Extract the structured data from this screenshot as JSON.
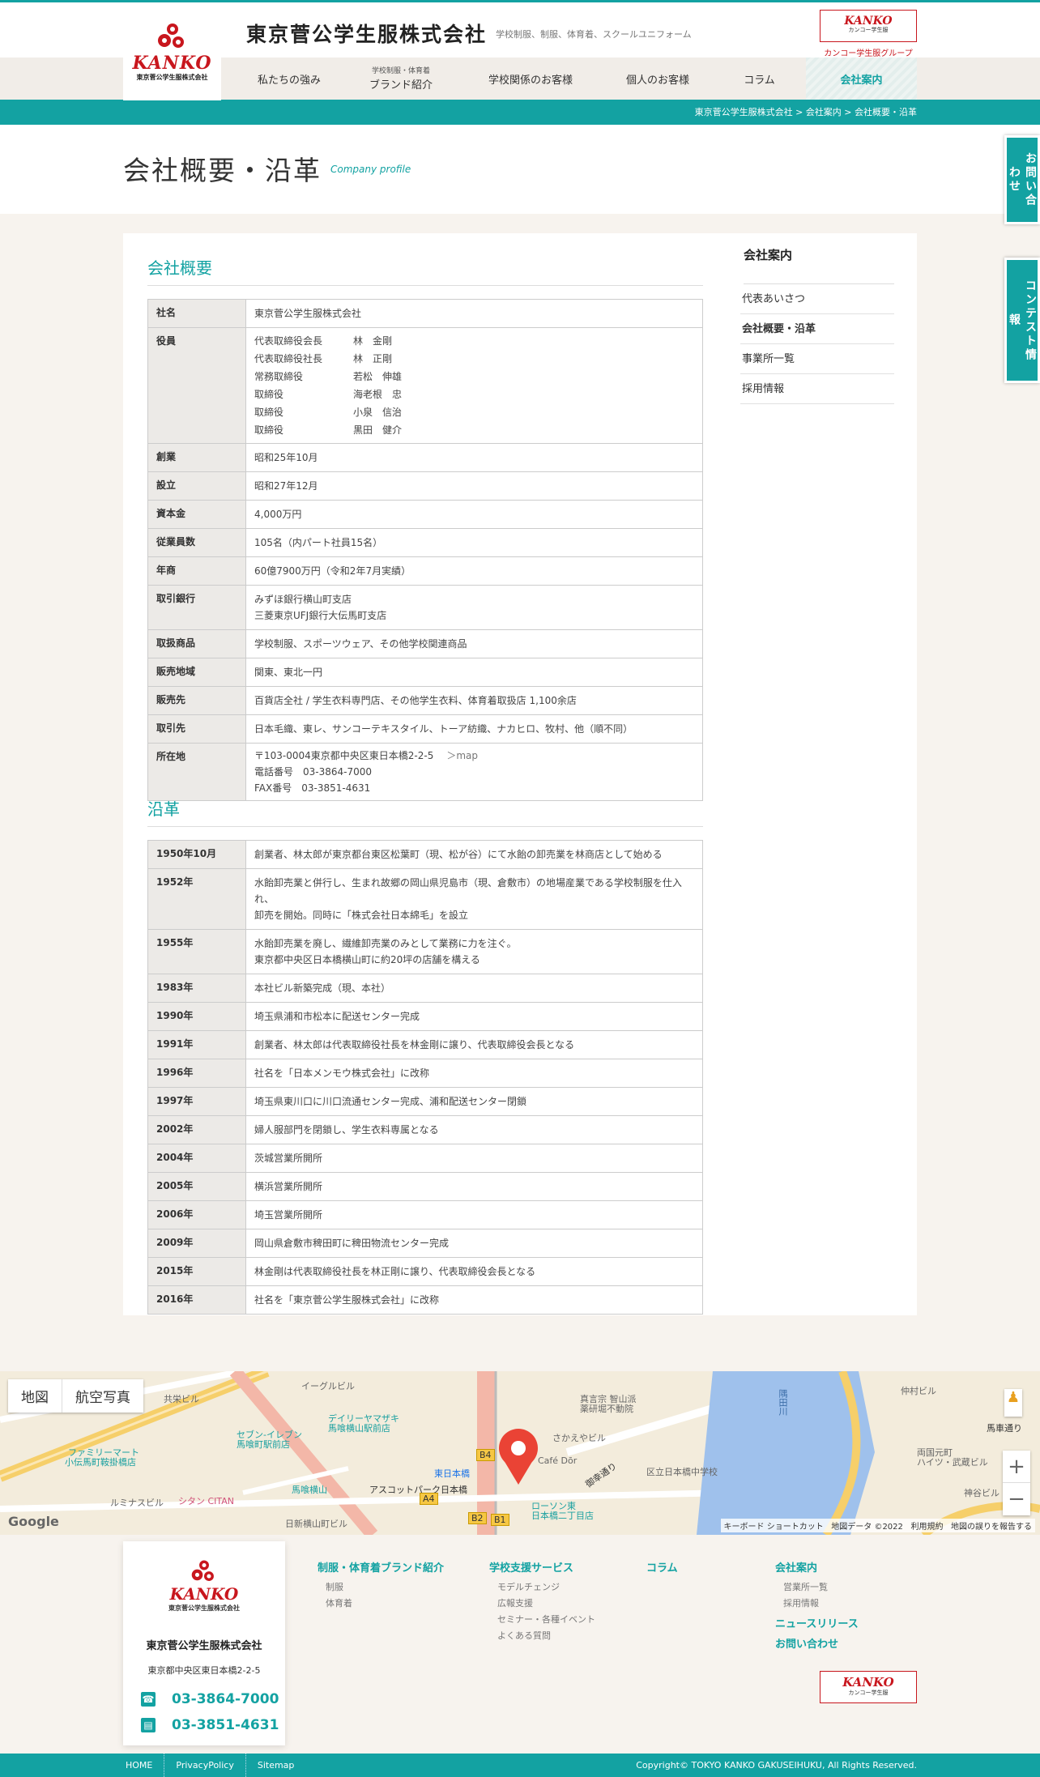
{
  "header": {
    "logo_brand": "KANKO",
    "logo_sub": "東京菅公学生服株式会社",
    "company_title": "東京菅公学生服株式会社",
    "tagline": "学校制服、制服、体育着、スクールユニフォーム",
    "group_logo_brand": "KANKO",
    "group_logo_sub": "カンコー学生服",
    "group_caption": "カンコー学生服グループ"
  },
  "nav": [
    {
      "label": "私たちの強み",
      "small": ""
    },
    {
      "label": "ブランド紹介",
      "small": "学校制服・体育着"
    },
    {
      "label": "学校関係のお客様",
      "small": ""
    },
    {
      "label": "個人のお客様",
      "small": ""
    },
    {
      "label": "コラム",
      "small": ""
    },
    {
      "label": "会社案内",
      "small": "",
      "active": true
    }
  ],
  "breadcrumb": "東京菅公学生服株式会社 > 会社案内 > 会社概要・沿革",
  "page": {
    "title": "会社概要・沿革",
    "title_en": "Company profile"
  },
  "overview": {
    "heading": "会社概要",
    "rows": [
      {
        "label": "社名",
        "value": "東京菅公学生服株式会社"
      },
      {
        "label": "創業",
        "value": "昭和25年10月"
      },
      {
        "label": "設立",
        "value": "昭和27年12月"
      },
      {
        "label": "資本金",
        "value": "4,000万円"
      },
      {
        "label": "従業員数",
        "value": "105名（内パート社員15名）"
      },
      {
        "label": "年商",
        "value": "60億7900万円（令和2年7月実績）"
      },
      {
        "label": "取引銀行",
        "lines": [
          "みずほ銀行横山町支店",
          "三菱東京UFJ銀行大伝馬町支店"
        ]
      },
      {
        "label": "取扱商品",
        "value": "学校制服、スポーツウェア、その他学校関連商品"
      },
      {
        "label": "販売地域",
        "value": "関東、東北一円"
      },
      {
        "label": "販売先",
        "value": "百貨店全社 / 学生衣料専門店、その他学生衣料、体育着取扱店 1,100余店"
      },
      {
        "label": "取引先",
        "value": "日本毛織、東レ、サンコーテキスタイル、トーア紡織、ナカヒロ、牧村、他（順不同）"
      }
    ],
    "officers_label": "役員",
    "officers": [
      {
        "role": "代表取締役会長",
        "name": "林　金剛"
      },
      {
        "role": "代表取締役社長",
        "name": "林　正剛"
      },
      {
        "role": "常務取締役",
        "name": "若松　伸雄"
      },
      {
        "role": "取締役",
        "name": "海老根　忠"
      },
      {
        "role": "取締役",
        "name": "小泉　信治"
      },
      {
        "role": "取締役",
        "name": "黒田　健介"
      }
    ],
    "address_label": "所在地",
    "address": "〒103-0004東京都中央区東日本橋2-2-5",
    "map_link": "＞map",
    "tel": "電話番号　03-3864-7000",
    "fax": "FAX番号　03-3851-4631"
  },
  "history": {
    "heading": "沿革",
    "rows": [
      {
        "year": "1950年10月",
        "lines": [
          "創業者、林太郎が東京都台東区松葉町（現、松が谷）にて水飴の卸売業を林商店として始める"
        ]
      },
      {
        "year": "1952年",
        "lines": [
          "水飴卸売業と併行し、生まれ故郷の岡山県児島市（現、倉敷市）の地場産業である学校制服を仕入れ、",
          "卸売を開始。同時に「株式会社日本綿毛」を設立"
        ]
      },
      {
        "year": "1955年",
        "lines": [
          "水飴卸売業を廃し、繊維卸売業のみとして業務に力を注ぐ。",
          "東京都中央区日本橋横山町に約20坪の店舗を構える"
        ]
      },
      {
        "year": "1983年",
        "lines": [
          "本社ビル新築完成（現、本社）"
        ]
      },
      {
        "year": "1990年",
        "lines": [
          "埼玉県浦和市松本に配送センター完成"
        ]
      },
      {
        "year": "1991年",
        "lines": [
          "創業者、林太郎は代表取締役社長を林金剛に譲り、代表取締役会長となる"
        ]
      },
      {
        "year": "1996年",
        "lines": [
          "社名を「日本メンモウ株式会社」に改称"
        ]
      },
      {
        "year": "1997年",
        "lines": [
          "埼玉県東川口に川口流通センター完成、浦和配送センター閉鎖"
        ]
      },
      {
        "year": "2002年",
        "lines": [
          "婦人服部門を閉鎖し、学生衣料専属となる"
        ]
      },
      {
        "year": "2004年",
        "lines": [
          "茨城営業所開所"
        ]
      },
      {
        "year": "2005年",
        "lines": [
          "横浜営業所開所"
        ]
      },
      {
        "year": "2006年",
        "lines": [
          "埼玉営業所開所"
        ]
      },
      {
        "year": "2009年",
        "lines": [
          "岡山県倉敷市稗田町に稗田物流センター完成"
        ]
      },
      {
        "year": "2015年",
        "lines": [
          "林金剛は代表取締役社長を林正剛に譲り、代表取締役会長となる"
        ]
      },
      {
        "year": "2016年",
        "lines": [
          "社名を「東京菅公学生服株式会社」に改称"
        ]
      }
    ]
  },
  "sidebar": {
    "title": "会社案内",
    "items": [
      {
        "label": "代表あいさつ"
      },
      {
        "label": "会社概要・沿革",
        "current": true
      },
      {
        "label": "事業所一覧"
      },
      {
        "label": "採用情報"
      }
    ]
  },
  "float_tabs": {
    "contact": "お問い合わせ",
    "contest": "コンテスト情報"
  },
  "map": {
    "btn_map": "地図",
    "btn_satellite": "航空写真",
    "labels": [
      "デイリーヤマザキ",
      "馬喰横山駅前店",
      "セブン-イレブン",
      "馬喰町駅前店",
      "ファミリーマート",
      "小伝馬町鞍掛橋店",
      "馬喰横山",
      "アスコットパーク日本橋",
      "シタン CITAN",
      "東日本橋",
      "ローソン東",
      "日本橋二丁目店",
      "区立日本橋中学校",
      "隅田川",
      "両国元町",
      "ハイツ・武蔵ビル",
      "Café Dōr",
      "真言宗 智山派",
      "薬研堀不動院",
      "さかえやビル",
      "馬車通り",
      "御幸通り",
      "イーグルビル",
      "共栄ビル",
      "日新横山町ビル",
      "ルミナスビル",
      "神谷ビル",
      "仲村ビル"
    ],
    "exits": [
      "B4",
      "A4",
      "B2",
      "B1"
    ],
    "attribution": [
      "キーボード ショートカット",
      "地図データ ©2022",
      "利用規約",
      "地図の誤りを報告する"
    ],
    "google": "Google"
  },
  "footer": {
    "brand": "KANKO",
    "brand_sub": "東京菅公学生服株式会社",
    "company": "東京菅公学生服株式会社",
    "address": "東京都中央区東日本橋2-2-5",
    "tel": "03-3864-7000",
    "fax": "03-3851-4631",
    "col1": {
      "heading": "制服・体育着ブランド紹介",
      "links": [
        "制服",
        "体育着"
      ]
    },
    "col2": {
      "heading": "学校支援サービス",
      "links": [
        "モデルチェンジ",
        "広報支援",
        "セミナー・各種イベント",
        "よくある質問"
      ]
    },
    "col3": {
      "heading": "コラム",
      "links": []
    },
    "col4": {
      "heading": "会社案内",
      "links": [
        "営業所一覧",
        "採用情報"
      ],
      "extra": [
        "ニュースリリース",
        "お問い合わせ"
      ]
    },
    "logo_brand": "KANKO",
    "logo_sub": "カンコー学生服"
  },
  "bottombar": {
    "links": [
      "HOME",
      "PrivacyPolicy",
      "Sitemap"
    ],
    "copyright": "Copyright© TOKYO KANKO GAKUSEIHUKU, All Rights Reserved."
  },
  "colors": {
    "accent": "#13a2a2",
    "brand_red": "#c8161d"
  }
}
